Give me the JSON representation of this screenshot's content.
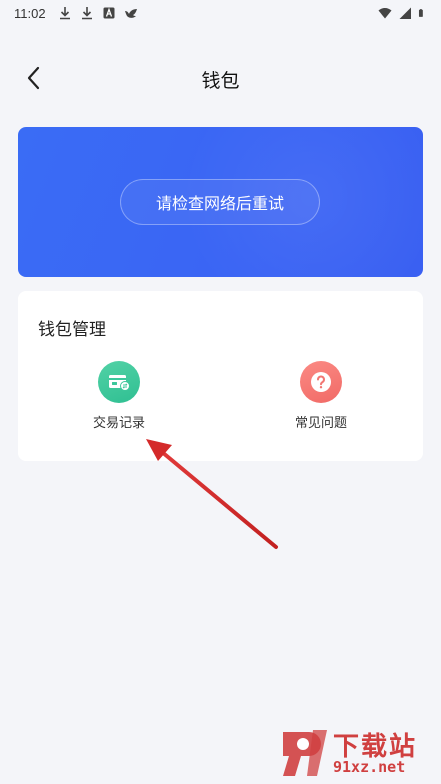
{
  "status_bar": {
    "time": "11:02"
  },
  "nav": {
    "title": "钱包"
  },
  "banner": {
    "retry_label": "请检查网络后重试"
  },
  "management": {
    "title": "钱包管理",
    "items": [
      {
        "label": "交易记录",
        "icon": "transaction-record-icon",
        "color": "#3cc79b"
      },
      {
        "label": "常见问题",
        "icon": "question-icon",
        "color": "#f27672"
      }
    ]
  },
  "colors": {
    "banner": "#3a66f4",
    "background": "#f4f5f9",
    "arrow": "#d42a2a"
  },
  "watermark": {
    "brand": "下载站",
    "url": "91xz.net"
  }
}
